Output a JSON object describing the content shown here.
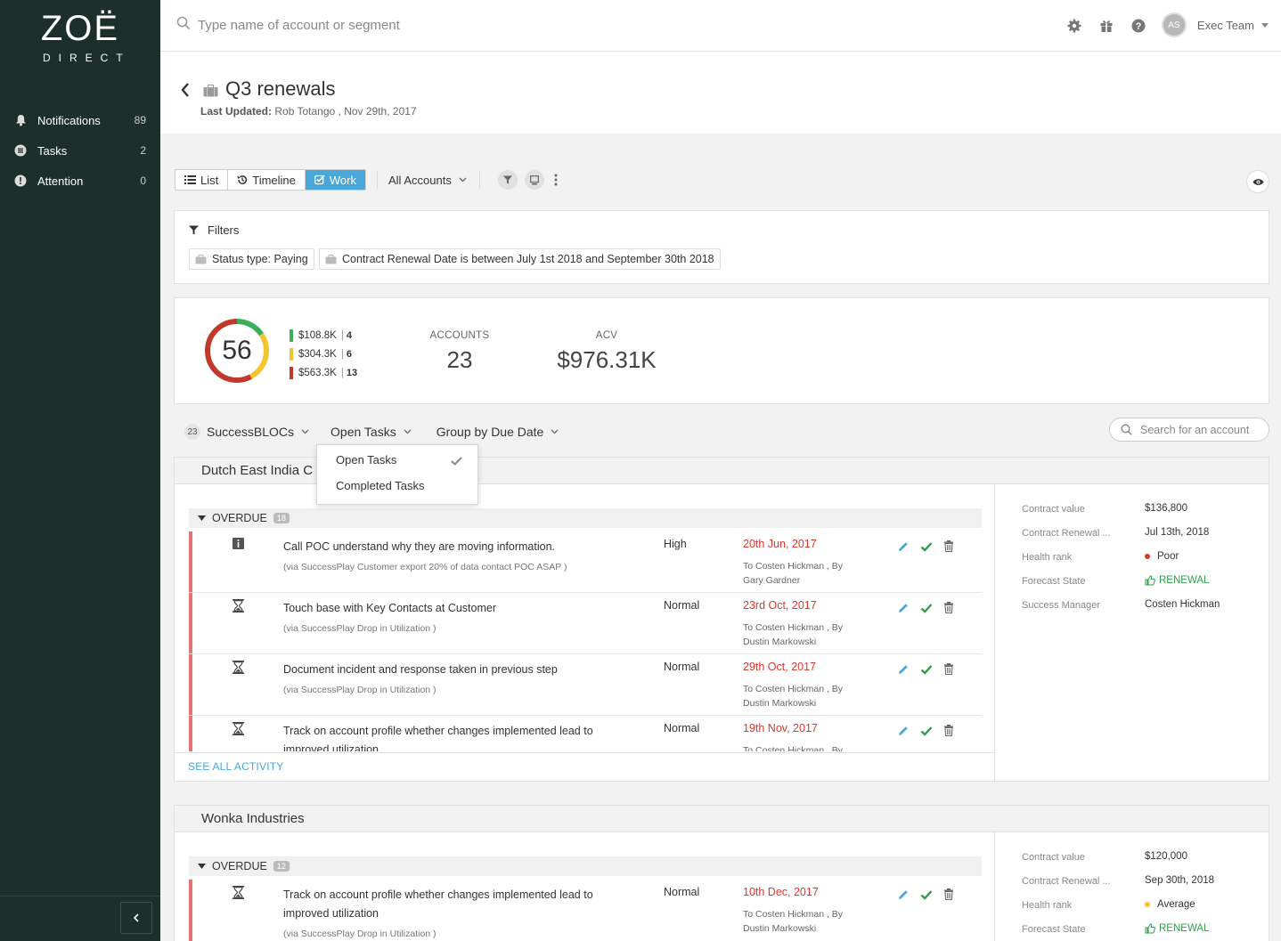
{
  "brand": {
    "name": "ZOË",
    "sub": "DIRECT"
  },
  "nav": [
    {
      "label": "Notifications",
      "count": "89",
      "icon": "bell-icon"
    },
    {
      "label": "Tasks",
      "count": "2",
      "icon": "tasks-icon"
    },
    {
      "label": "Attention",
      "count": "0",
      "icon": "attention-icon"
    }
  ],
  "topbar": {
    "search_placeholder": "Type name of account or segment",
    "user_initials": "AS",
    "user_name": "Exec Team"
  },
  "page": {
    "title": "Q3 renewals",
    "updated_label": "Last Updated:",
    "updated_value": "Rob Totango , Nov 29th, 2017"
  },
  "views": {
    "list": "List",
    "timeline": "Timeline",
    "work": "Work",
    "active": "Work",
    "accounts_filter": "All Accounts"
  },
  "filters": {
    "title": "Filters",
    "chips": [
      "Status type: Paying",
      "Contract Renewal Date is between July 1st 2018 and September 30th 2018"
    ]
  },
  "summary": {
    "score": "56",
    "legend": [
      {
        "value": "$108.8K",
        "count": "4",
        "color": "#3cae5c"
      },
      {
        "value": "$304.3K",
        "count": "6",
        "color": "#f2c531"
      },
      {
        "value": "$563.3K",
        "count": "13",
        "color": "#c0392b"
      }
    ],
    "accounts_label": "ACCOUNTS",
    "accounts_value": "23",
    "acv_label": "ACV",
    "acv_value": "$976.31K"
  },
  "grouping": {
    "count": "23",
    "blocs": "SuccessBLOCs",
    "task_filter": "Open Tasks",
    "group_by": "Group by Due Date",
    "search_placeholder": "Search for an account"
  },
  "dropdown": {
    "items": [
      "Open Tasks",
      "Completed Tasks"
    ],
    "selected": "Open Tasks"
  },
  "accounts": [
    {
      "name": "Dutch East India C",
      "overdue_label": "OVERDUE",
      "overdue_count": "18",
      "tasks": [
        {
          "title": "Call POC understand why they are moving information.",
          "sub": "(via SuccessPlay Customer export 20% of data contact POC ASAP )",
          "priority": "High",
          "date": "20th Jun, 2017",
          "to": "To Costen Hickman , By",
          "by": "Gary Gardner",
          "icon": "info-icon"
        },
        {
          "title": "Touch base with Key Contacts at Customer",
          "sub": "(via SuccessPlay Drop in Utilization )",
          "priority": "Normal",
          "date": "23rd Oct, 2017",
          "to": "To Costen Hickman , By",
          "by": "Dustin Markowski",
          "icon": "hourglass-icon"
        },
        {
          "title": "Document incident and response taken in previous step",
          "sub": "(via SuccessPlay Drop in Utilization )",
          "priority": "Normal",
          "date": "29th Oct, 2017",
          "to": "To Costen Hickman , By",
          "by": "Dustin Markowski",
          "icon": "hourglass-icon"
        },
        {
          "title": "Track on account profile whether changes implemented lead to improved utilization",
          "sub": "",
          "priority": "Normal",
          "date": "19th Nov, 2017",
          "to": "To Costen Hickman , By",
          "by": "",
          "icon": "hourglass-icon"
        }
      ],
      "see_all": "SEE ALL ACTIVITY",
      "details": [
        {
          "label": "Contract value",
          "value": "$136,800"
        },
        {
          "label": "Contract Renewal ...",
          "value": "Jul 13th, 2018"
        },
        {
          "label": "Health rank",
          "value": "Poor",
          "dot": "#d9372c"
        },
        {
          "label": "Forecast State",
          "value": "RENEWAL"
        },
        {
          "label": "Success Manager",
          "value": "Costen Hickman"
        }
      ]
    },
    {
      "name": "Wonka Industries",
      "overdue_label": "OVERDUE",
      "overdue_count": "12",
      "tasks": [
        {
          "title": "Track on account profile whether changes implemented lead to improved utilization",
          "sub": "(via SuccessPlay Drop in Utilization )",
          "priority": "Normal",
          "date": "10th Dec, 2017",
          "to": "To Costen Hickman , By",
          "by": "Dustin Markowski",
          "icon": "hourglass-icon"
        }
      ],
      "details": [
        {
          "label": "Contract value",
          "value": "$120,000"
        },
        {
          "label": "Contract Renewal ...",
          "value": "Sep 30th, 2018"
        },
        {
          "label": "Health rank",
          "value": "Average",
          "dot": "#f2c531"
        },
        {
          "label": "Forecast State",
          "value": "RENEWAL"
        }
      ]
    }
  ]
}
